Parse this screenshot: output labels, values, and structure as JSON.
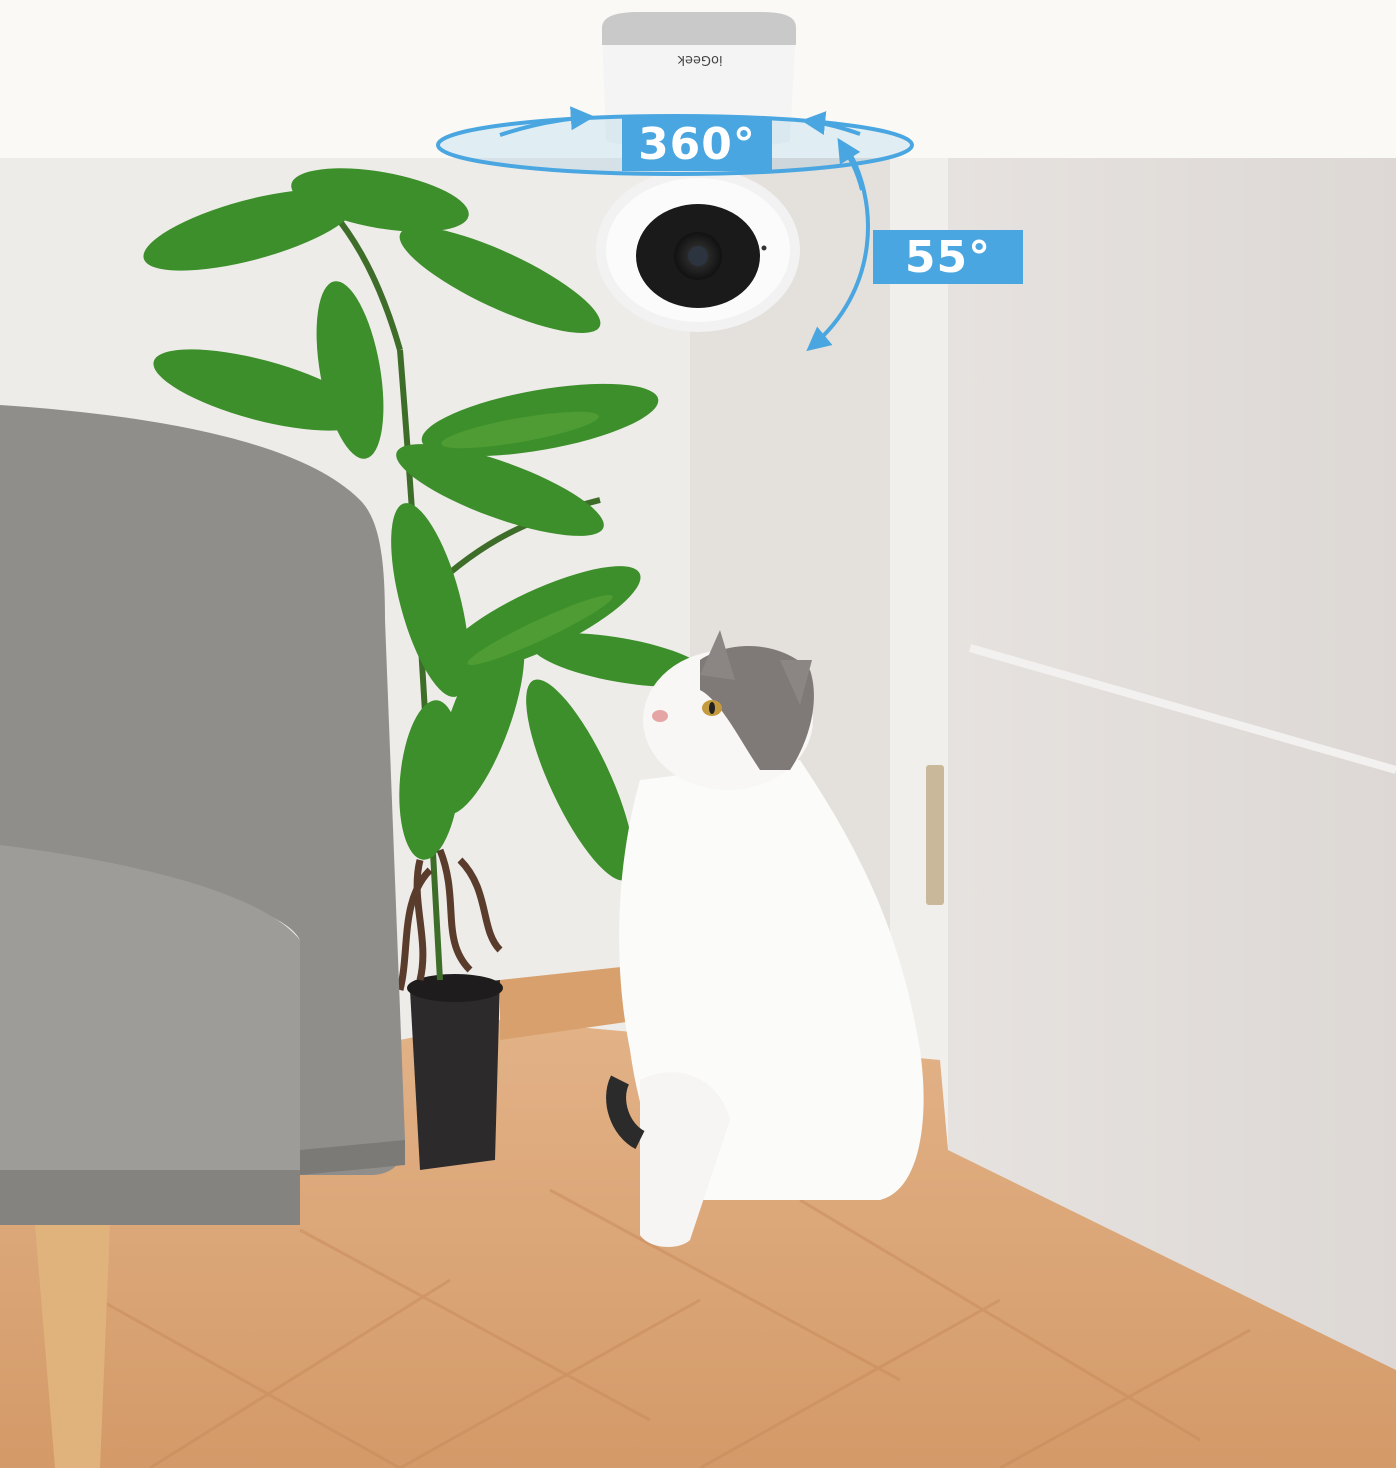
{
  "badges": {
    "pan": "360°",
    "tilt": "55°"
  },
  "camera": {
    "brand": "ioGeek"
  },
  "colors": {
    "accent": "#4aa6e0",
    "wall": "#ece9e6",
    "floor": "#d9a779"
  }
}
